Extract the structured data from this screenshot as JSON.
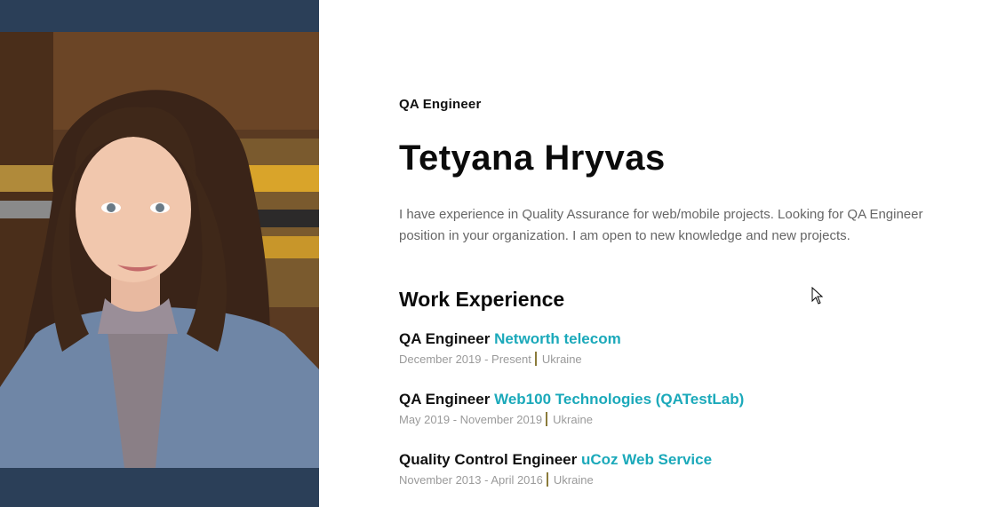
{
  "profile": {
    "job_title": "QA Engineer",
    "name": "Tetyana Hryvas",
    "summary": "I have experience in Quality Assurance for web/mobile projects. Looking for QA Engineer position in your organization. I am open to new knowledge and new projects."
  },
  "work_experience": {
    "heading": "Work Experience",
    "jobs": [
      {
        "role": "QA Engineer",
        "company": "Networth telecom",
        "dates": "December 2019 - Present",
        "location": "Ukraine"
      },
      {
        "role": "QA Engineer",
        "company": "Web100 Technologies (QATestLab)",
        "dates": "May 2019 - November 2019",
        "location": "Ukraine"
      },
      {
        "role": "Quality Control Engineer",
        "company": "uCoz Web Service",
        "dates": "November 2013 - April 2016",
        "location": "Ukraine"
      }
    ]
  },
  "colors": {
    "sidebar": "#2b3f58",
    "accent": "#1ba9ba",
    "muted": "#9a9a9a"
  }
}
